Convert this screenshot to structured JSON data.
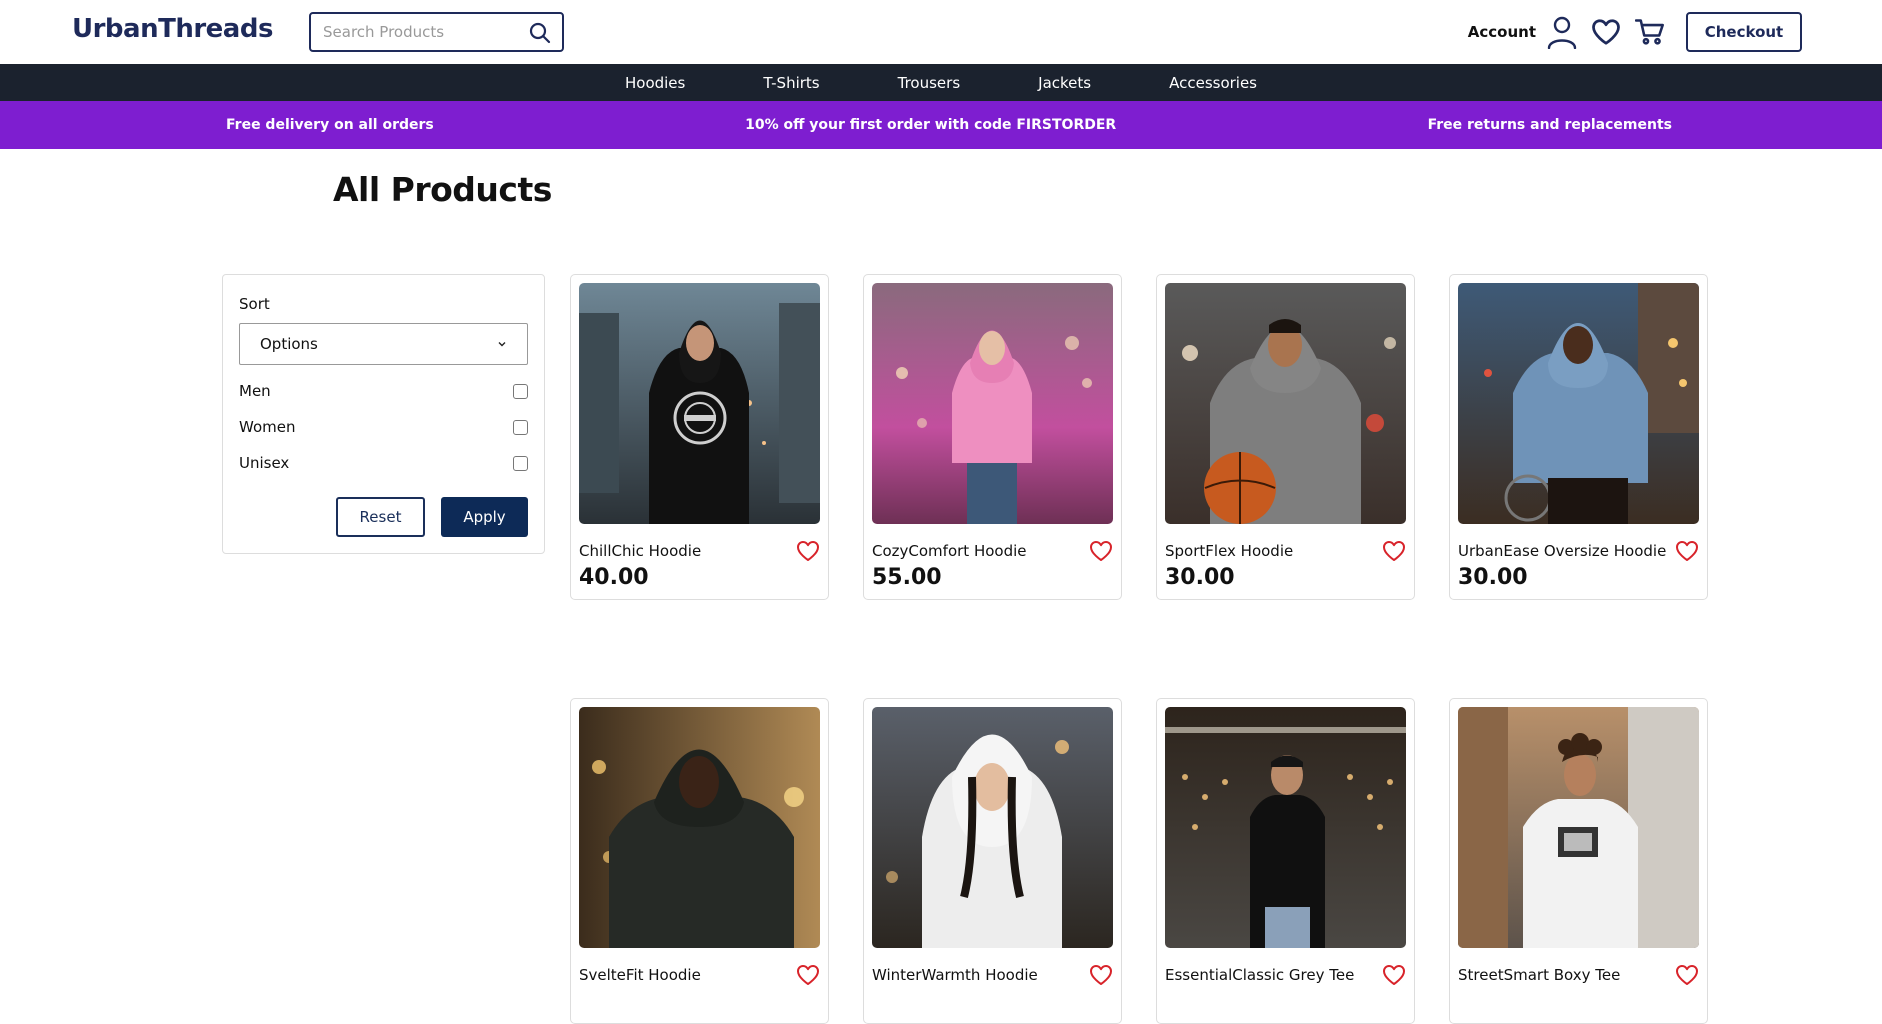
{
  "header": {
    "logo": "UrbanThreads",
    "search_placeholder": "Search Products",
    "account_label": "Account",
    "checkout_label": "Checkout"
  },
  "nav": {
    "items": [
      "Hoodies",
      "T-Shirts",
      "Trousers",
      "Jackets",
      "Accessories"
    ]
  },
  "promo": {
    "left": "Free delivery on all orders",
    "center": "10% off your first order with code FIRSTORDER",
    "right": "Free returns and replacements"
  },
  "page": {
    "title": "All Products"
  },
  "filters": {
    "sort_label": "Sort",
    "sort_value": "Options",
    "options": [
      "Men",
      "Women",
      "Unisex"
    ],
    "reset_label": "Reset",
    "apply_label": "Apply"
  },
  "products": [
    {
      "name": "ChillChic Hoodie",
      "price": "40.00"
    },
    {
      "name": "CozyComfort Hoodie",
      "price": "55.00"
    },
    {
      "name": "SportFlex Hoodie",
      "price": "30.00"
    },
    {
      "name": "UrbanEase Oversize Hoodie",
      "price": "30.00"
    },
    {
      "name": "SvelteFit Hoodie",
      "price": ""
    },
    {
      "name": "WinterWarmth Hoodie",
      "price": ""
    },
    {
      "name": "EssentialClassic Grey Tee",
      "price": ""
    },
    {
      "name": "StreetSmart Boxy Tee",
      "price": ""
    }
  ],
  "colors": {
    "brand_navy": "#1e2a5a",
    "nav_dark": "#1b222e",
    "promo_purple": "#7e1ed0",
    "heart_red": "#d8232a"
  }
}
